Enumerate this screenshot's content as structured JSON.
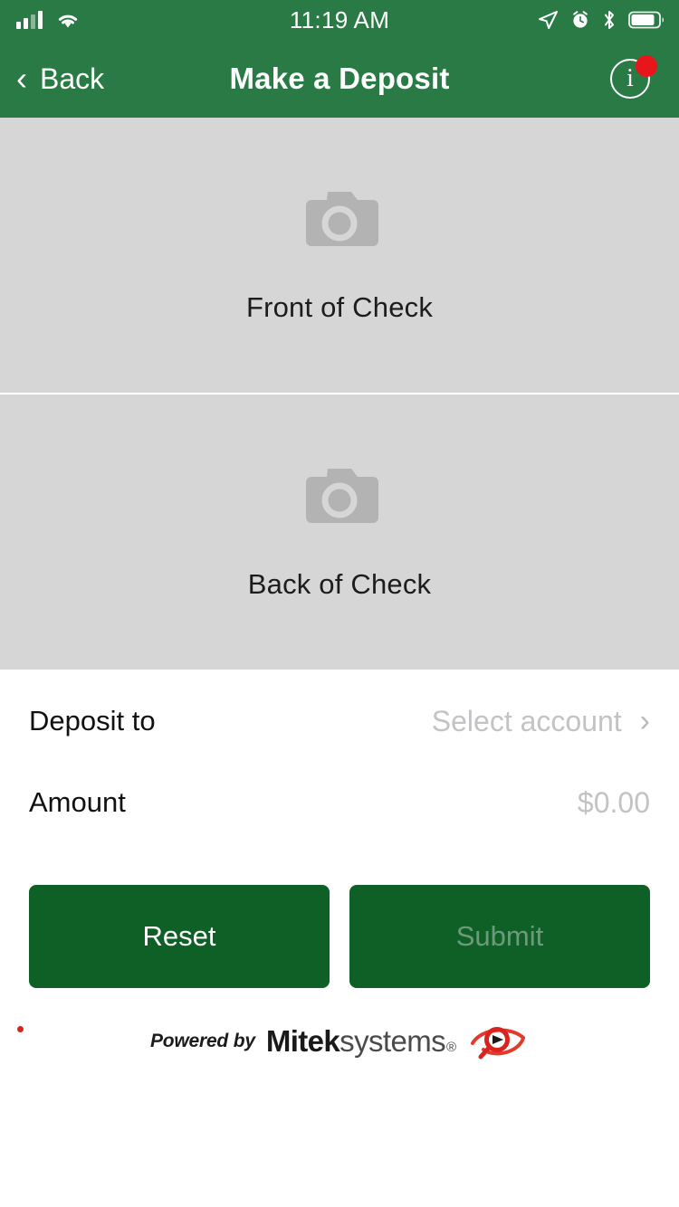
{
  "status_bar": {
    "time": "11:19 AM",
    "left_icons": [
      "cellular-signal-icon",
      "wifi-icon"
    ],
    "right_icons": [
      "location-arrow-icon",
      "alarm-clock-icon",
      "bluetooth-icon",
      "battery-icon"
    ],
    "signal_bars_filled": 2,
    "signal_bars_total": 4,
    "battery_level_percent": 78
  },
  "nav": {
    "back_label": "Back",
    "back_chevron": "‹",
    "title": "Make a Deposit",
    "info_glyph": "i",
    "info_badge_visible": true
  },
  "capture": {
    "front": {
      "label": "Front of Check",
      "icon": "camera-icon",
      "captured": false
    },
    "back": {
      "label": "Back of Check",
      "icon": "camera-icon",
      "captured": false
    }
  },
  "form": {
    "deposit_to": {
      "label": "Deposit to",
      "value": "Select account",
      "chevron": "›",
      "is_placeholder": true
    },
    "amount": {
      "label": "Amount",
      "value": "$0.00",
      "is_placeholder": true
    }
  },
  "actions": {
    "reset_label": "Reset",
    "submit_label": "Submit",
    "submit_enabled": false
  },
  "footer": {
    "powered_by": "Powered by",
    "brand_bold": "Mitek",
    "brand_light": "systems",
    "registered_mark": "®",
    "logo": "mitek-eye-logo"
  },
  "colors": {
    "header_green": "#2a7a45",
    "button_green": "#0f6026",
    "panel_grey": "#d6d6d6",
    "placeholder_grey": "#c3c3c6",
    "badge_red": "#e8151b",
    "logo_red": "#d8231f"
  }
}
